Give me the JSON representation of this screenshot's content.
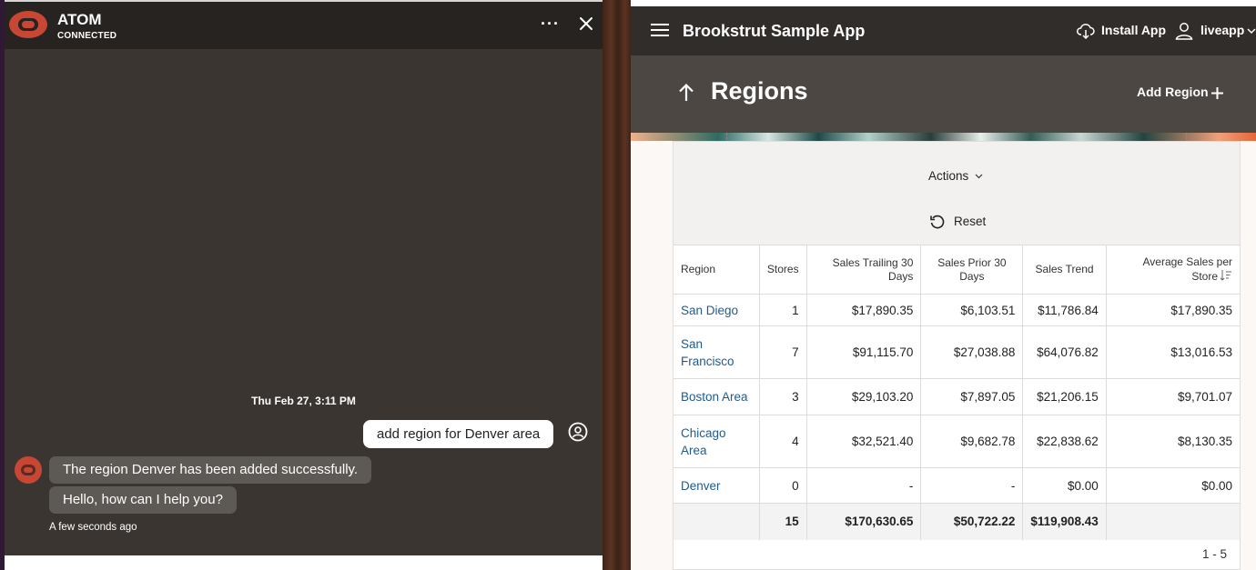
{
  "chat": {
    "title": "ATOM",
    "status": "CONNECTED",
    "more_label": "···",
    "date_label": "Thu Feb 27, 3:11 PM",
    "user_message": "add region for Denver area",
    "bot_messages": [
      "The region Denver has been added successfully.",
      "Hello, how can I help you?"
    ],
    "time_label": "A few seconds ago",
    "colors": {
      "brand": "#c74634",
      "header": "#262320",
      "body": "#3a3531",
      "bubble": "#5d5955"
    }
  },
  "app": {
    "title": "Brookstrut Sample App",
    "install_label": "Install App",
    "user_label": "liveapp",
    "page_title": "Regions",
    "add_label": "Add Region",
    "actions_label": "Actions",
    "reset_label": "Reset",
    "pagination": "1 - 5",
    "icons": [
      "menu-icon",
      "cloud-download-icon",
      "user-icon",
      "chevron-down-icon",
      "arrow-up-icon",
      "plus-icon",
      "reset-icon",
      "sort-icon"
    ]
  },
  "table": {
    "headers": [
      "Region",
      "Stores",
      "Sales Trailing 30 Days",
      "Sales Prior 30 Days",
      "Sales Trend",
      "Average Sales per Store"
    ],
    "rows": [
      {
        "region": "San Diego",
        "stores": "1",
        "trailing": "$17,890.35",
        "prior": "$6,103.51",
        "trend": "$11,786.84",
        "avg": "$17,890.35"
      },
      {
        "region": "San Francisco",
        "stores": "7",
        "trailing": "$91,115.70",
        "prior": "$27,038.88",
        "trend": "$64,076.82",
        "avg": "$13,016.53"
      },
      {
        "region": "Boston Area",
        "stores": "3",
        "trailing": "$29,103.20",
        "prior": "$7,897.05",
        "trend": "$21,206.15",
        "avg": "$9,701.07"
      },
      {
        "region": "Chicago Area",
        "stores": "4",
        "trailing": "$32,521.40",
        "prior": "$9,682.78",
        "trend": "$22,838.62",
        "avg": "$8,130.35"
      },
      {
        "region": "Denver",
        "stores": "0",
        "trailing": "-",
        "prior": "-",
        "trend": "$0.00",
        "avg": "$0.00"
      }
    ],
    "totals": {
      "stores": "15",
      "trailing": "$170,630.65",
      "prior": "$50,722.22",
      "trend": "$119,908.43"
    }
  }
}
